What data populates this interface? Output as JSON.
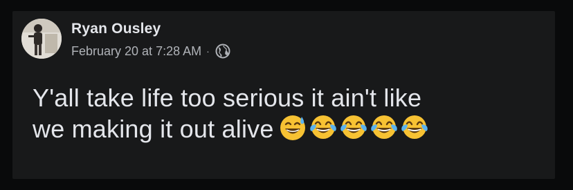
{
  "post": {
    "author": {
      "name": "Ryan Ousley"
    },
    "timestamp": "February 20 at 7:28 AM",
    "separator": "·",
    "privacy_icon": "globe-icon",
    "text_line_1": "Y'all take life too serious it ain't like",
    "text_line_2": "we making it out alive",
    "emojis": [
      "sweat-smile-emoji",
      "tears-of-joy-emoji",
      "tears-of-joy-emoji",
      "tears-of-joy-emoji",
      "tears-of-joy-emoji"
    ]
  },
  "colors": {
    "background": "#090a0b",
    "card": "#18191a",
    "primary_text": "#e4e6eb",
    "secondary_text": "#b0b3b8",
    "emoji_yellow": "#f7c233"
  }
}
